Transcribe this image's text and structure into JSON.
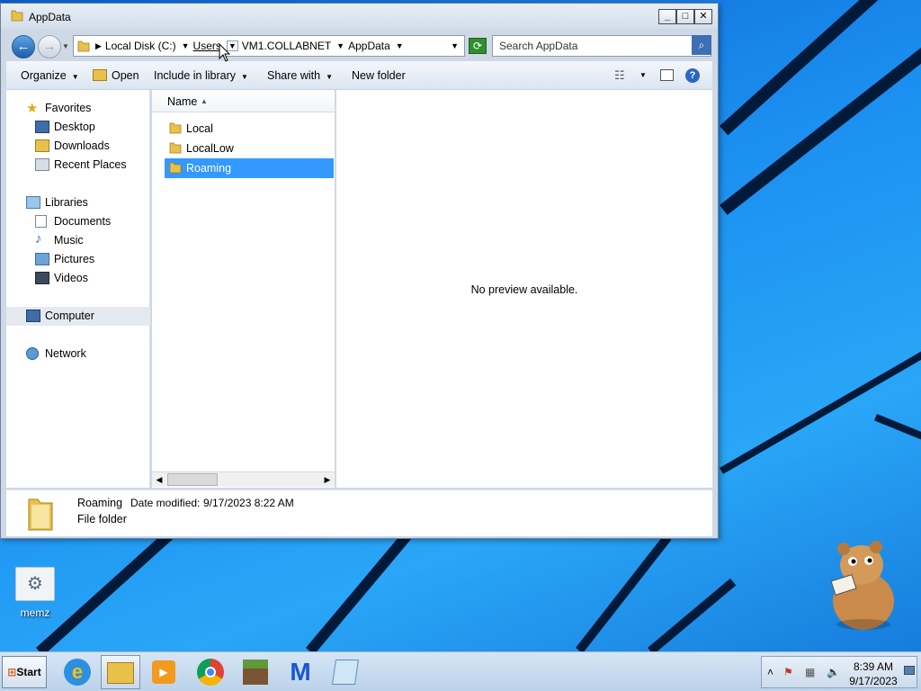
{
  "window": {
    "title": "AppData",
    "caption": {
      "minimize": "_",
      "maximize": "□",
      "close": "✕"
    }
  },
  "address": {
    "back_glyph": "←",
    "forward_glyph": "→",
    "crumbs": [
      "Local Disk (C:)",
      "Users",
      "VM1.COLLABNET",
      "AppData"
    ],
    "search_placeholder": "Search AppData"
  },
  "toolbar": {
    "organize": "Organize",
    "open": "Open",
    "include_in_library": "Include in library",
    "share_with": "Share with",
    "new_folder": "New folder"
  },
  "sidebar": {
    "favorites": {
      "label": "Favorites",
      "items": [
        "Desktop",
        "Downloads",
        "Recent Places"
      ]
    },
    "libraries": {
      "label": "Libraries",
      "items": [
        "Documents",
        "Music",
        "Pictures",
        "Videos"
      ]
    },
    "computer": "Computer",
    "network": "Network"
  },
  "filelist": {
    "column_name": "Name",
    "sort_glyph": "▲",
    "items": [
      "Local",
      "LocalLow",
      "Roaming"
    ],
    "selected": "Roaming"
  },
  "preview": {
    "message": "No preview available."
  },
  "details": {
    "name": "Roaming",
    "modified_label": "Date modified:",
    "modified_value": "9/17/2023 8:22 AM",
    "type": "File folder"
  },
  "desktop": {
    "icons": [
      {
        "label": "memz"
      }
    ]
  },
  "taskbar": {
    "start_label": "Start",
    "apps": [
      "internet-explorer",
      "file-explorer",
      "media-player",
      "chrome",
      "minecraft",
      "malwarebytes",
      "notepad"
    ],
    "clock_time": "8:39 AM",
    "clock_date": "9/17/2023"
  },
  "colors": {
    "selection": "#3399ff",
    "desktop_bg": "#1b8ff0",
    "window_frame": "#cfd9e6"
  }
}
